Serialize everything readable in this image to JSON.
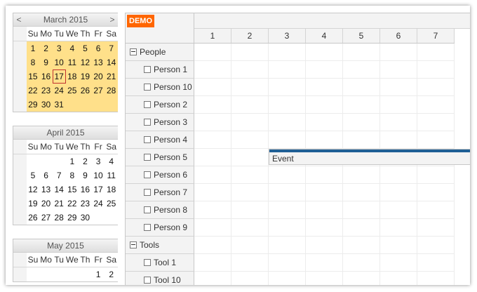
{
  "navigator": {
    "prev_arrow": "<",
    "next_arrow": ">",
    "weekdays": [
      "Su",
      "Mo",
      "Tu",
      "We",
      "Th",
      "Fr",
      "Sa"
    ],
    "months": [
      {
        "title": "March 2015",
        "weeks": [
          [
            "1",
            "2",
            "3",
            "4",
            "5",
            "6",
            "7"
          ],
          [
            "8",
            "9",
            "10",
            "11",
            "12",
            "13",
            "14"
          ],
          [
            "15",
            "16",
            "17",
            "18",
            "19",
            "20",
            "21"
          ],
          [
            "22",
            "23",
            "24",
            "25",
            "26",
            "27",
            "28"
          ],
          [
            "29",
            "30",
            "31",
            "",
            "",
            "",
            ""
          ]
        ]
      },
      {
        "title": "April 2015",
        "weeks": [
          [
            "",
            "",
            "",
            "1",
            "2",
            "3",
            "4"
          ],
          [
            "5",
            "6",
            "7",
            "8",
            "9",
            "10",
            "11"
          ],
          [
            "12",
            "13",
            "14",
            "15",
            "16",
            "17",
            "18"
          ],
          [
            "19",
            "20",
            "21",
            "22",
            "23",
            "24",
            "25"
          ],
          [
            "26",
            "27",
            "28",
            "29",
            "30",
            "",
            ""
          ]
        ]
      },
      {
        "title": "May 2015",
        "weeks": [
          [
            "",
            "",
            "",
            "",
            "",
            "1",
            "2"
          ]
        ]
      }
    ],
    "selected_highlight_color": "#ffe08a",
    "today": "17"
  },
  "scheduler": {
    "corner_badge": "DEMO",
    "badge_color": "#ff6600",
    "days": [
      "1",
      "2",
      "3",
      "4",
      "5",
      "6",
      "7"
    ],
    "rows": [
      {
        "type": "group",
        "label": "People"
      },
      {
        "type": "resource",
        "label": "Person 1"
      },
      {
        "type": "resource",
        "label": "Person 10"
      },
      {
        "type": "resource",
        "label": "Person 2"
      },
      {
        "type": "resource",
        "label": "Person 3"
      },
      {
        "type": "resource",
        "label": "Person 4"
      },
      {
        "type": "resource",
        "label": "Person 5"
      },
      {
        "type": "resource",
        "label": "Person 6"
      },
      {
        "type": "resource",
        "label": "Person 7"
      },
      {
        "type": "resource",
        "label": "Person 8"
      },
      {
        "type": "resource",
        "label": "Person 9"
      },
      {
        "type": "group",
        "label": "Tools"
      },
      {
        "type": "resource",
        "label": "Tool 1"
      },
      {
        "type": "resource",
        "label": "Tool 10"
      }
    ],
    "event": {
      "text": "Event",
      "resource": "Person 5",
      "start_day": "3",
      "bar_color": "#1f5f95"
    }
  }
}
